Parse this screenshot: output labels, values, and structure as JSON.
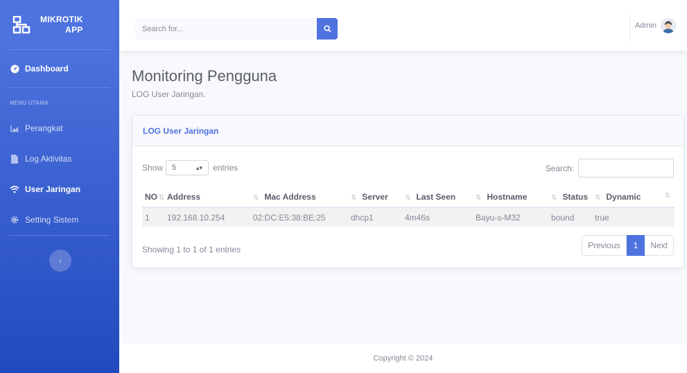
{
  "brand": {
    "line1": "MIKROTIK",
    "line2": "APP",
    "icon": "network-icon"
  },
  "sidebar": {
    "dashboard": "Dashboard",
    "heading": "MENU UTAMA",
    "items": [
      {
        "label": "Perangkat",
        "icon": "chart-area-icon"
      },
      {
        "label": "Log Aktivitas",
        "icon": "file-icon"
      },
      {
        "label": "User Jaringan",
        "icon": "wifi-icon"
      },
      {
        "label": "Setting Sistem",
        "icon": "gear-icon"
      }
    ],
    "toggle": "‹"
  },
  "topbar": {
    "search_placeholder": "Search for...",
    "user_name": "Admin"
  },
  "page": {
    "title": "Monitoring Pengguna",
    "subtitle": "LOG User Jaringan."
  },
  "card": {
    "title": "LOG User Jaringan",
    "show_label": "Show",
    "entries_value": "5",
    "entries_label": "entries",
    "search_label": "Search:",
    "columns": [
      "NO",
      "Address",
      "Mac Address",
      "Server",
      "Last Seen",
      "Hostname",
      "Status",
      "Dynamic"
    ],
    "rows": [
      [
        "1",
        "192.168.10.254",
        "02:DC:E5:38:BE:25",
        "dhcp1",
        "4m46s",
        "Bayu-s-M32",
        "bound",
        "true"
      ]
    ],
    "info": "Showing 1 to 1 of 1 entries",
    "pager": {
      "prev": "Previous",
      "current": "1",
      "next": "Next"
    }
  },
  "footer": {
    "text": "Copyright © 2024"
  },
  "colors": {
    "primary": "#4e73df",
    "sidebar_end": "#224abe"
  }
}
